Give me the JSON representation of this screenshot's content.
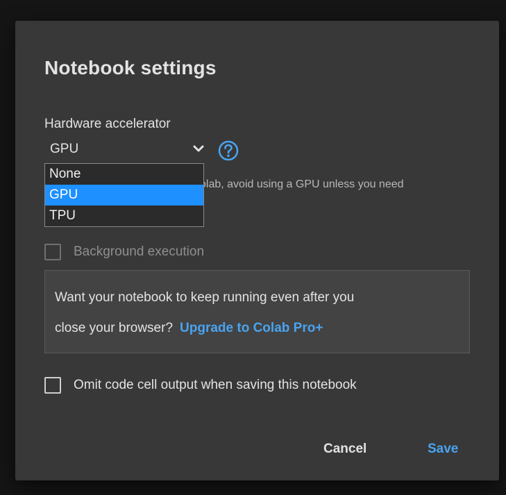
{
  "dialog": {
    "title": "Notebook settings"
  },
  "hardware": {
    "label": "Hardware accelerator",
    "selected_value": "GPU",
    "options": [
      {
        "label": "None",
        "selected": false
      },
      {
        "label": "GPU",
        "selected": true
      },
      {
        "label": "TPU",
        "selected": false
      }
    ],
    "hint_text": "olab, avoid using a GPU unless you need"
  },
  "background_execution": {
    "label": "Background execution",
    "checked": false,
    "disabled": true
  },
  "promo": {
    "line1": "Want your notebook to keep running even after you",
    "line2": "close your browser?",
    "link_label": "Upgrade to Colab Pro+"
  },
  "omit_output": {
    "label": "Omit code cell output when saving this notebook",
    "checked": false
  },
  "actions": {
    "cancel_label": "Cancel",
    "save_label": "Save"
  },
  "colors": {
    "accent": "#4aa3f0",
    "selected_option": "#1e90ff",
    "dialog_bg": "#383838",
    "backdrop_bg": "#151515"
  },
  "icons": {
    "dropdown": "chevron-down-icon",
    "help": "help-circle-icon"
  }
}
